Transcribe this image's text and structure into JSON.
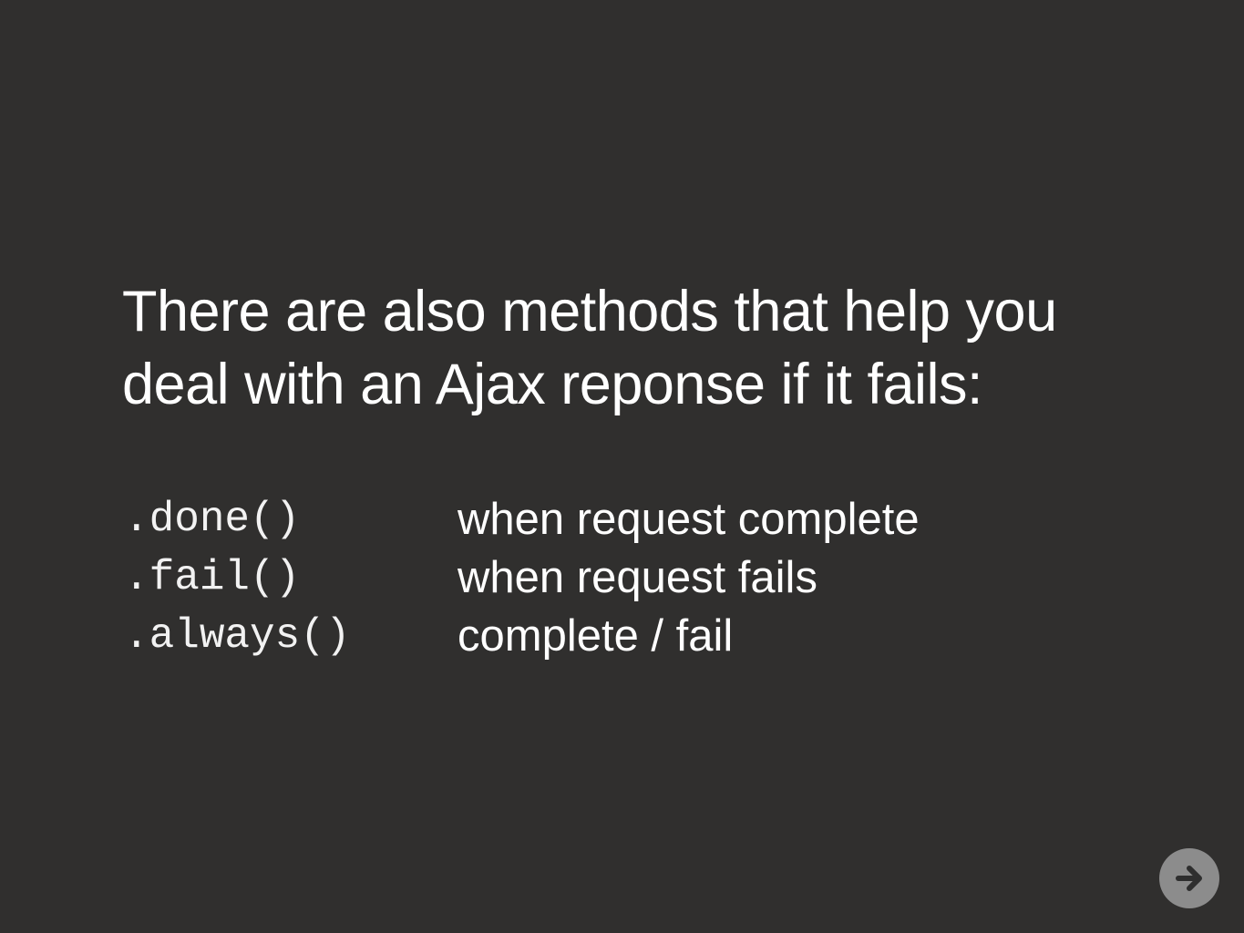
{
  "slide": {
    "heading_line1": "There are also methods that help you",
    "heading_line2": "deal with an Ajax reponse if it fails:",
    "methods": [
      {
        "code": ".done()",
        "description": "when request complete"
      },
      {
        "code": ".fail()",
        "description": "when request fails"
      },
      {
        "code": ".always()",
        "description": "complete / fail"
      }
    ]
  },
  "navigation": {
    "next_icon": "arrow-right-icon"
  },
  "colors": {
    "background": "#302f2e",
    "text": "#ffffff",
    "nav_button": "#8c8c8c",
    "nav_arrow": "#2e2e2e"
  }
}
